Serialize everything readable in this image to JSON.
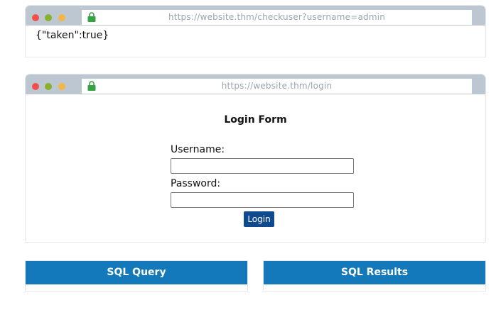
{
  "window1": {
    "url": "https://website.thm/checkuser?username=admin",
    "response": "{\"taken\":true}"
  },
  "window2": {
    "url": "https://website.thm/login",
    "form_title": "Login Form",
    "username_label": "Username:",
    "username_value": "",
    "password_label": "Password:",
    "password_value": "",
    "login_button": "Login"
  },
  "panels": {
    "query_title": "SQL Query",
    "results_title": "SQL Results"
  },
  "colors": {
    "browser_bar": "#bdc7d1",
    "login_button": "#0f4a8f",
    "panel_header": "#1379ba",
    "lock": "#37a244"
  }
}
